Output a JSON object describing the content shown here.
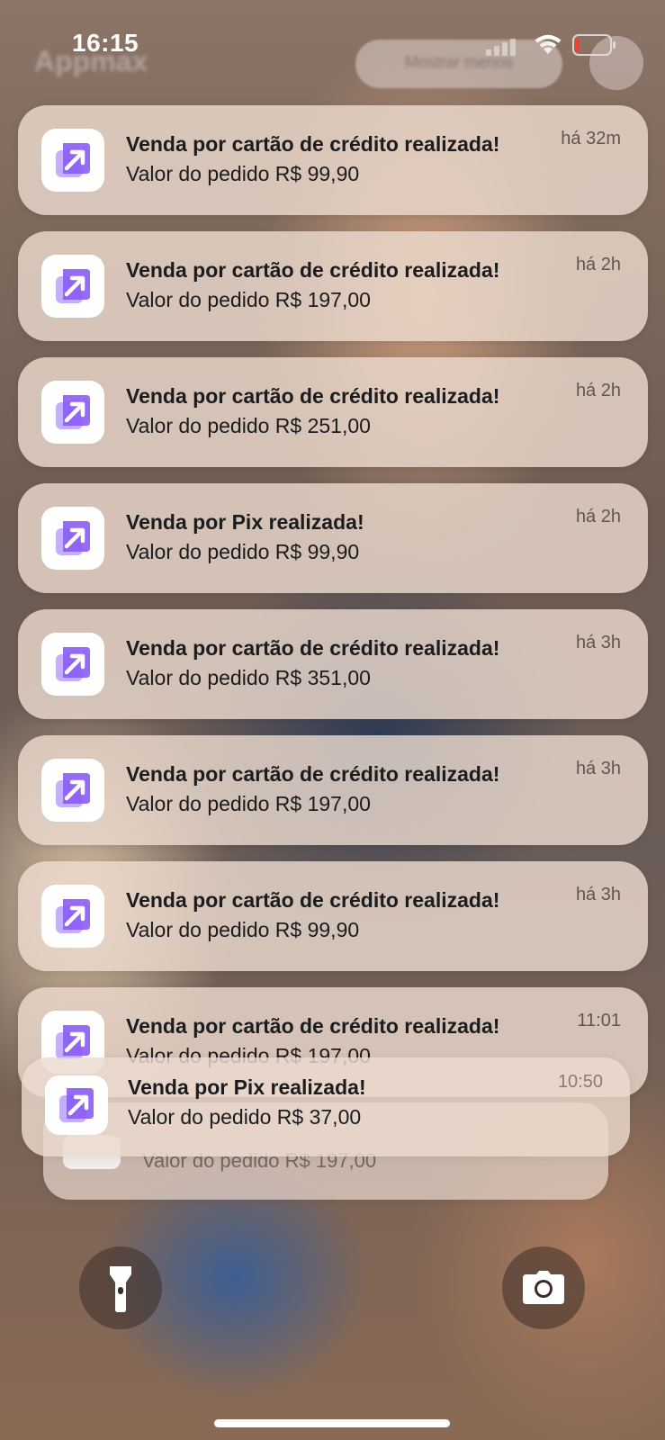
{
  "status_bar": {
    "time": "16:15",
    "battery_level": 0.1,
    "battery_color": "#ff3b30"
  },
  "background": {
    "blurred_app_name": "Appmax",
    "blurred_pill_label": "Mostrar menos"
  },
  "notifications": [
    {
      "title": "Venda por cartão de crédito realizada!",
      "body": "Valor do pedido R$ 99,90",
      "time": "há 32m",
      "icon": "appmax-logo-icon"
    },
    {
      "title": "Venda por cartão de crédito realizada!",
      "body": "Valor do pedido R$ 197,00",
      "time": "há 2h",
      "icon": "appmax-logo-icon"
    },
    {
      "title": "Venda por cartão de crédito realizada!",
      "body": "Valor do pedido R$ 251,00",
      "time": "há 2h",
      "icon": "appmax-logo-icon"
    },
    {
      "title": "Venda por Pix realizada!",
      "body": "Valor do pedido R$ 99,90",
      "time": "há 2h",
      "icon": "appmax-logo-icon"
    },
    {
      "title": "Venda por cartão de crédito realizada!",
      "body": "Valor do pedido R$ 351,00",
      "time": "há 3h",
      "icon": "appmax-logo-icon"
    },
    {
      "title": "Venda por cartão de crédito realizada!",
      "body": "Valor do pedido R$ 197,00",
      "time": "há 3h",
      "icon": "appmax-logo-icon"
    },
    {
      "title": "Venda por cartão de crédito realizada!",
      "body": "Valor do pedido R$ 99,90",
      "time": "há 3h",
      "icon": "appmax-logo-icon"
    },
    {
      "title": "Venda por cartão de crédito realizada!",
      "body": "Valor do pedido R$ 197,00",
      "time": "11:01",
      "icon": "appmax-logo-icon"
    }
  ],
  "stack": [
    {
      "title": "Venda por Pix realizada!",
      "body": "Valor do pedido R$ 37,00",
      "time": "10:50"
    },
    {
      "body": "Valor do pedido R$ 197,00"
    }
  ],
  "controls": {
    "left": "flashlight-icon",
    "right": "camera-icon"
  },
  "colors": {
    "icon_purple": "#8b5cf6",
    "icon_purple_light": "#c4b0f9"
  }
}
